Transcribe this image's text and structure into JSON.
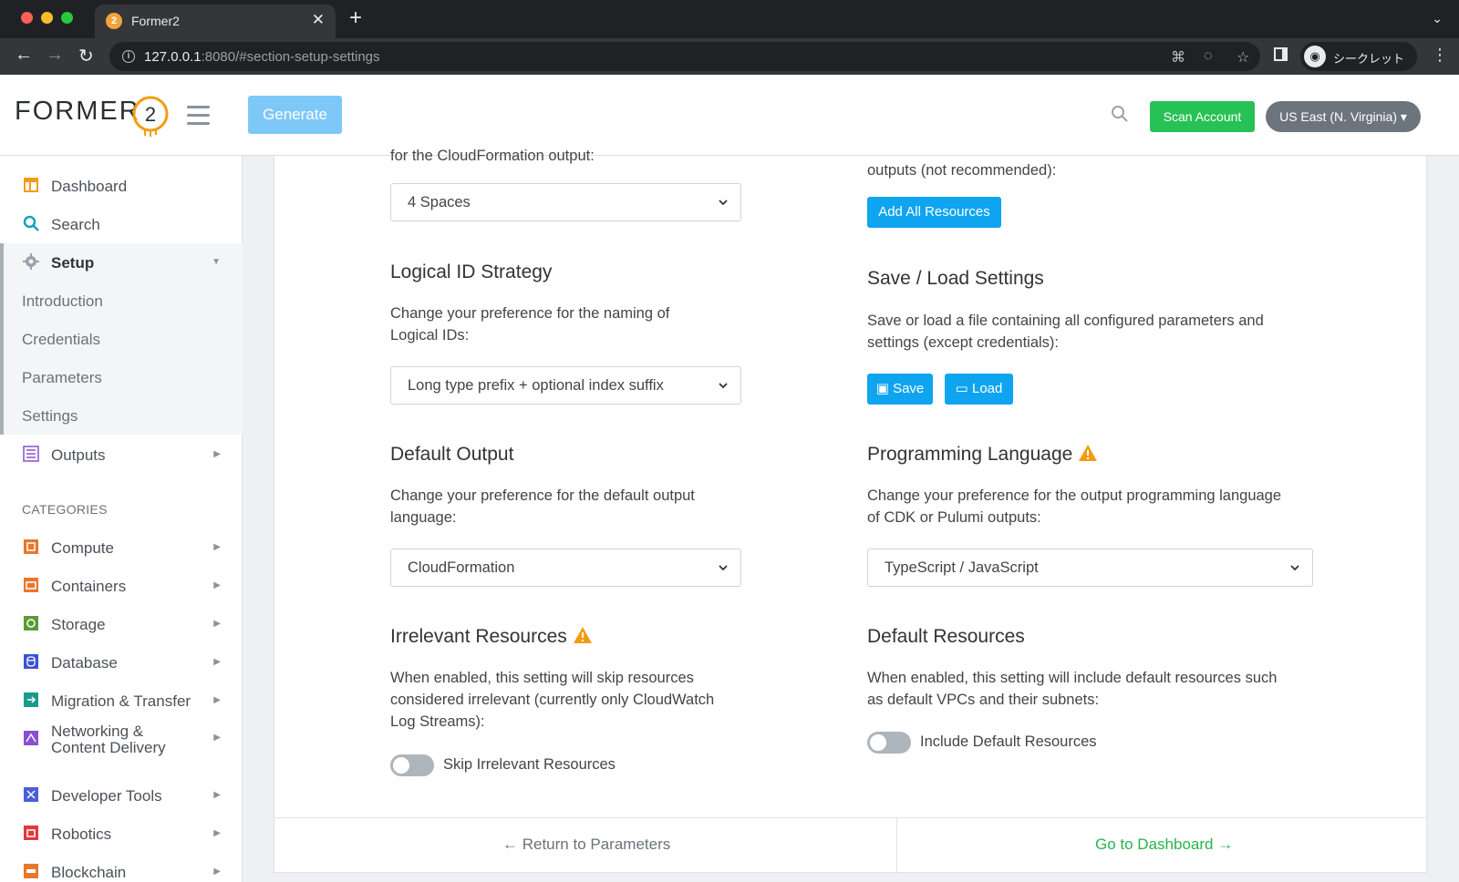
{
  "browser": {
    "tab_title": "Former2",
    "url_host": "127.0.0.1",
    "url_rest": ":8080/#section-setup-settings",
    "profile_label": "シークレット"
  },
  "header": {
    "logo_text": "FORMER",
    "generate_label": "Generate",
    "scan_label": "Scan Account",
    "region_label": "US East (N. Virginia) ▾"
  },
  "sidebar": {
    "items": [
      {
        "label": "Dashboard"
      },
      {
        "label": "Search"
      },
      {
        "label": "Setup"
      },
      {
        "label": "Outputs"
      }
    ],
    "setup_sub": [
      "Introduction",
      "Credentials",
      "Parameters",
      "Settings"
    ],
    "categories_title": "CATEGORIES",
    "categories": [
      {
        "label": "Compute",
        "color": "#e8772e"
      },
      {
        "label": "Containers",
        "color": "#e8772e"
      },
      {
        "label": "Storage",
        "color": "#5b9b34"
      },
      {
        "label": "Database",
        "color": "#3b52d4"
      },
      {
        "label": "Migration & Transfer",
        "color": "#1b9b8a"
      },
      {
        "label": "Networking &",
        "label2": "Content Delivery",
        "color": "#8a4fd0"
      },
      {
        "label": "Developer Tools",
        "color": "#4a5fd8"
      },
      {
        "label": "Robotics",
        "color": "#e0393e"
      },
      {
        "label": "Blockchain",
        "color": "#e8772e"
      }
    ]
  },
  "main": {
    "top_left_partial": "for the CloudFormation output:",
    "indent_select": "4 Spaces",
    "top_right_partial": "outputs (not recommended):",
    "add_all_label": "Add All Resources",
    "logical_id": {
      "title": "Logical ID Strategy",
      "desc1": "Change your preference for the naming of",
      "desc2": "Logical IDs:",
      "select": "Long type prefix + optional index suffix"
    },
    "save_load": {
      "title": "Save / Load Settings",
      "desc1": "Save or load a file containing all configured parameters and",
      "desc2": "settings (except credentials):",
      "save_label": "Save",
      "load_label": "Load"
    },
    "default_output": {
      "title": "Default Output",
      "desc1": "Change your preference for the default output",
      "desc2": "language:",
      "select": "CloudFormation"
    },
    "programming_language": {
      "title": "Programming Language",
      "desc1": "Change your preference for the output programming language",
      "desc2": "of CDK or Pulumi outputs:",
      "select": "TypeScript / JavaScript"
    },
    "irrelevant": {
      "title": "Irrelevant Resources",
      "desc1": "When enabled, this setting will skip resources",
      "desc2": "considered irrelevant (currently only CloudWatch",
      "desc3": "Log Streams):",
      "toggle_label": "Skip Irrelevant Resources"
    },
    "default_resources": {
      "title": "Default Resources",
      "desc1": "When enabled, this setting will include default resources such",
      "desc2": "as default VPCs and their subnets:",
      "toggle_label": "Include Default Resources"
    },
    "footer_left": "← Return to Parameters",
    "footer_right": "Go to Dashboard →"
  },
  "colors": {
    "accent_blue": "#0fa4f0",
    "scan_green": "#28c155",
    "warning_orange": "#f39c12"
  }
}
